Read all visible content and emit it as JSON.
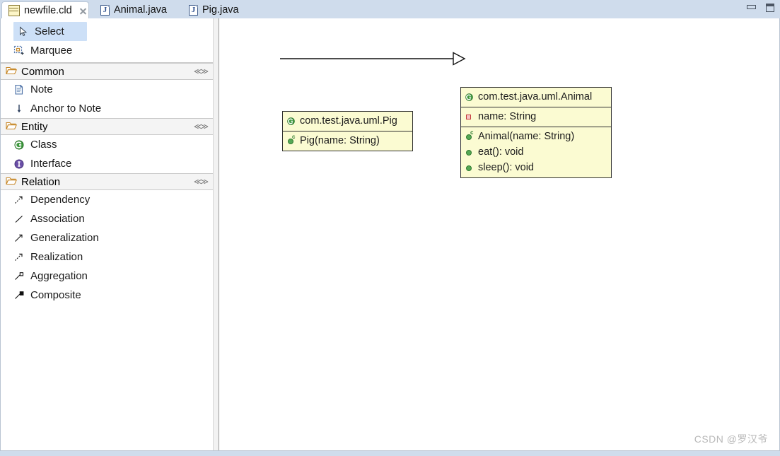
{
  "window": {
    "controls": {
      "minimize_label": "Minimize",
      "maximize_label": "Maximize"
    }
  },
  "tabs": [
    {
      "label": "newfile.cld",
      "icon": "class-diagram-icon",
      "active": true,
      "closable": true
    },
    {
      "label": "Animal.java",
      "icon": "java-file-icon",
      "active": false,
      "closable": false
    },
    {
      "label": "Pig.java",
      "icon": "java-file-icon",
      "active": false,
      "closable": false
    }
  ],
  "palette": {
    "tools": [
      {
        "label": "Select",
        "icon": "cursor-arrow-icon",
        "selected": true
      },
      {
        "label": "Marquee",
        "icon": "marquee-select-icon",
        "selected": false
      }
    ],
    "groups": [
      {
        "label": "Common",
        "icon": "open-folder-icon",
        "collapse_icon": "double-chevron-icon",
        "items": [
          {
            "label": "Note",
            "icon": "note-document-icon"
          },
          {
            "label": "Anchor to Note",
            "icon": "anchor-arrow-icon"
          }
        ]
      },
      {
        "label": "Entity",
        "icon": "open-folder-icon",
        "collapse_icon": "double-chevron-icon",
        "items": [
          {
            "label": "Class",
            "icon": "class-green-icon"
          },
          {
            "label": "Interface",
            "icon": "interface-purple-icon"
          }
        ]
      },
      {
        "label": "Relation",
        "icon": "open-folder-icon",
        "collapse_icon": "double-chevron-icon",
        "items": [
          {
            "label": "Dependency",
            "icon": "dashed-open-arrow-icon"
          },
          {
            "label": "Association",
            "icon": "plain-line-icon"
          },
          {
            "label": "Generalization",
            "icon": "solid-open-arrow-icon"
          },
          {
            "label": "Realization",
            "icon": "dashed-hollow-arrow-icon"
          },
          {
            "label": "Aggregation",
            "icon": "hollow-diamond-icon"
          },
          {
            "label": "Composite",
            "icon": "filled-diamond-icon"
          }
        ]
      }
    ]
  },
  "diagram": {
    "classes": [
      {
        "id": "pig",
        "name": "com.test.java.uml.Pig",
        "name_icon": "class-green-icon",
        "attributes": [],
        "operations": [
          {
            "label": "Pig(name: String)",
            "icon": "constructor-icon"
          }
        ]
      },
      {
        "id": "animal",
        "name": "com.test.java.uml.Animal",
        "name_icon": "class-green-icon",
        "attributes": [
          {
            "label": "name: String",
            "icon": "private-field-icon"
          }
        ],
        "operations": [
          {
            "label": "Animal(name: String)",
            "icon": "constructor-icon"
          },
          {
            "label": "eat(): void",
            "icon": "method-icon"
          },
          {
            "label": "sleep(): void",
            "icon": "method-icon"
          }
        ]
      }
    ],
    "relations": [
      {
        "type": "generalization",
        "from": "pig",
        "to": "animal",
        "arrow": "hollow-triangle"
      }
    ]
  },
  "watermark": {
    "text": "CSDN @罗汉爷"
  },
  "colors": {
    "uml_fill": "#fbfbd2",
    "uml_border": "#2f2f2f",
    "selection": "#cde0f7",
    "tabbar": "#cfdcec",
    "group_header": "#f4f4f4"
  }
}
